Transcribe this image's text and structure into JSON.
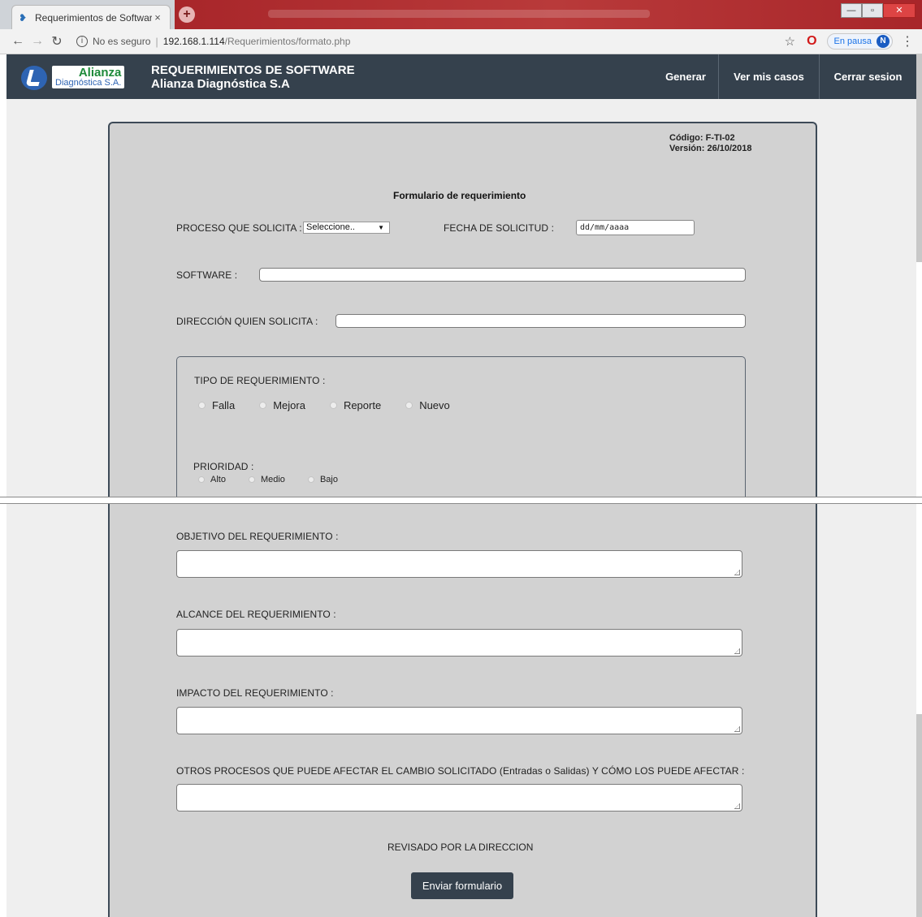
{
  "browser": {
    "tab_title": "Requerimientos de Software",
    "tab_close": "×",
    "new_tab": "+",
    "not_secure": "No es seguro",
    "url_host": "192.168.1.114",
    "url_path": "/Requerimientos/formato.php",
    "pause_label": "En pausa",
    "profile_initial": "N"
  },
  "header": {
    "logo_line1": "Alianza",
    "logo_line2": "Diagnóstica S.A.",
    "title_line1": "REQUERIMIENTOS DE SOFTWARE",
    "title_line2": "Alianza Diagnóstica S.A",
    "nav": [
      "Generar",
      "Ver mis casos",
      "Cerrar sesion"
    ]
  },
  "form": {
    "codigo": "Código: F-TI-02",
    "version": "Versión: 26/10/2018",
    "title": "Formulario de requerimiento",
    "proceso_label": "PROCESO QUE SOLICITA :",
    "proceso_value": "Seleccione..",
    "fecha_label": "FECHA DE SOLICITUD :",
    "fecha_placeholder": "dd/mm/aaaa",
    "software_label": "SOFTWARE :",
    "direccion_label": "DIRECCIÓN QUIEN SOLICITA :",
    "tipo_label": "TIPO DE REQUERIMIENTO :",
    "tipo_options": [
      "Falla",
      "Mejora",
      "Reporte",
      "Nuevo"
    ],
    "prioridad_label": "PRIORIDAD :",
    "prioridad_options": [
      "Alto",
      "Medio",
      "Bajo"
    ],
    "objetivo_label": "OBJETIVO DEL REQUERIMIENTO :",
    "alcance_label": "ALCANCE DEL REQUERIMIENTO :",
    "impacto_label": "IMPACTO DEL REQUERIMIENTO :",
    "otros_label": "OTROS PROCESOS QUE PUEDE AFECTAR EL CAMBIO SOLICITADO (Entradas o Salidas) Y CÓMO LOS PUEDE AFECTAR :",
    "reviewed_label": "REVISADO POR LA DIRECCION",
    "submit_label": "Enviar formulario"
  }
}
